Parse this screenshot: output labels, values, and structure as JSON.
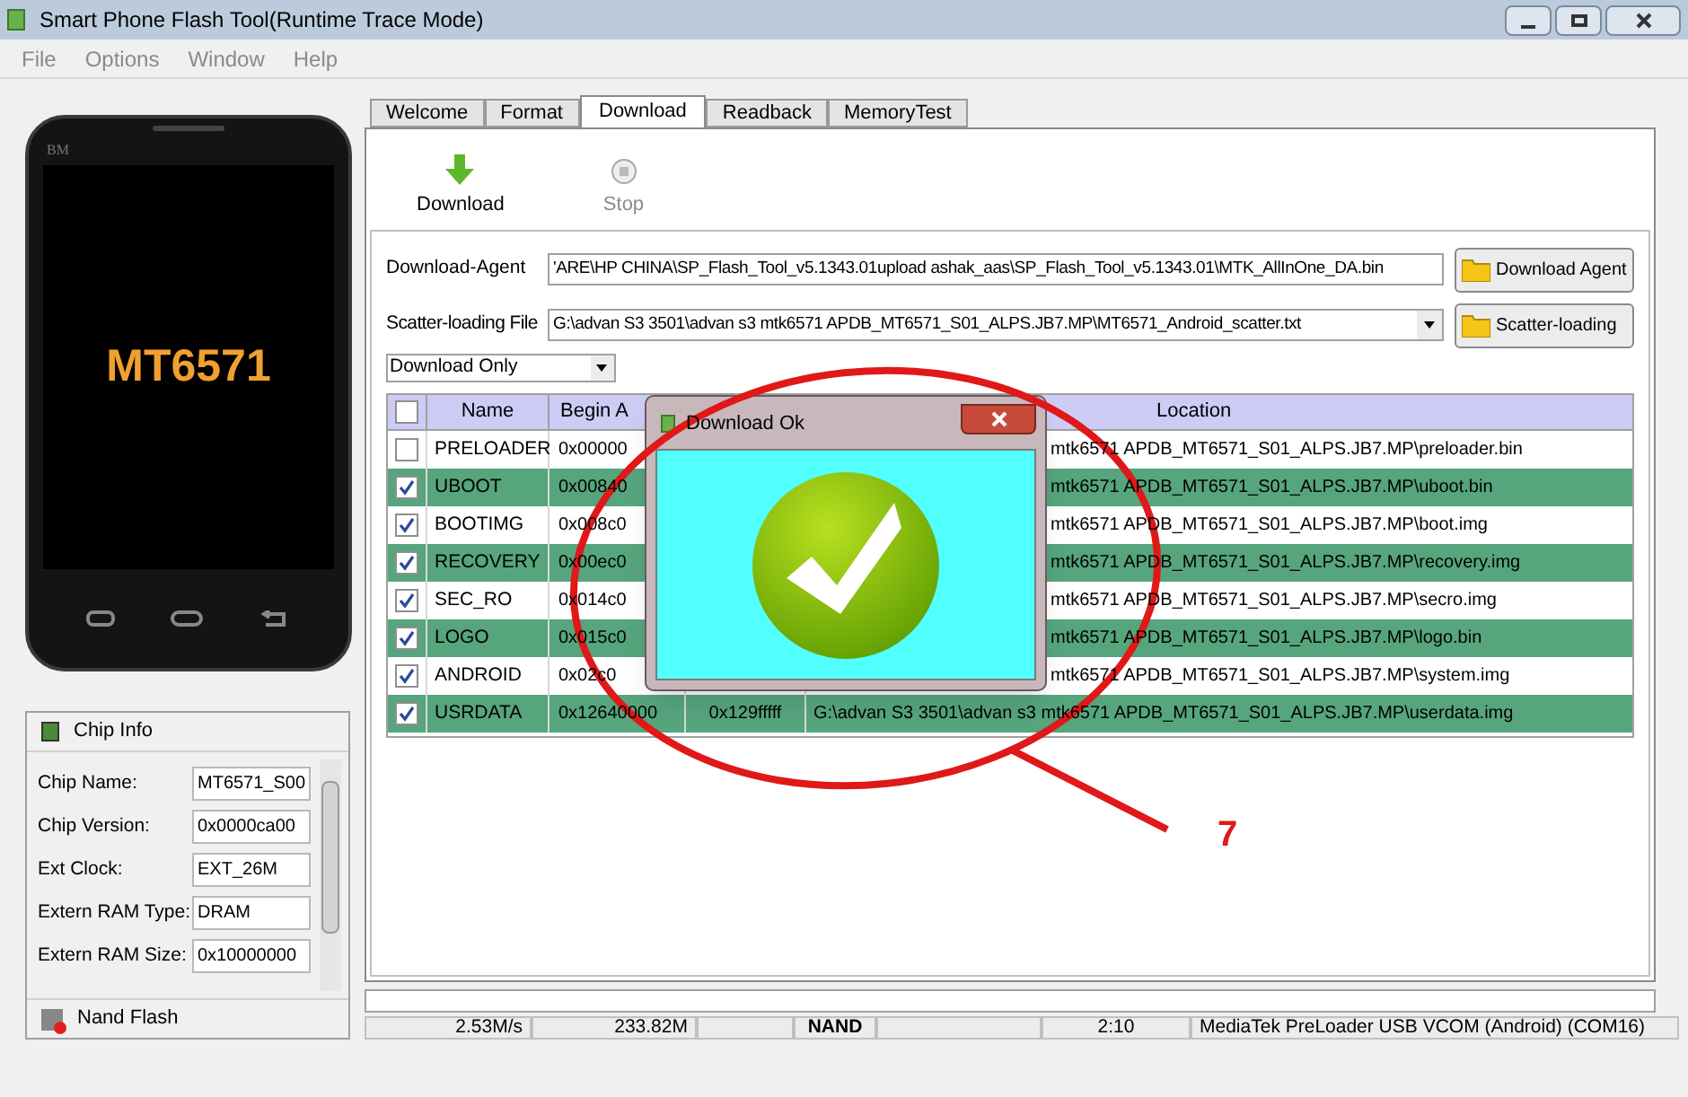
{
  "window": {
    "title": "Smart Phone Flash Tool(Runtime Trace Mode)"
  },
  "menu": [
    {
      "label": "File",
      "disabled": true
    },
    {
      "label": "Options",
      "disabled": true
    },
    {
      "label": "Window",
      "disabled": true
    },
    {
      "label": "Help",
      "disabled": true
    }
  ],
  "phone": {
    "brand": "BM",
    "chip": "MT6571"
  },
  "chip_info": {
    "title": "Chip Info",
    "fields": [
      {
        "label": "Chip Name:",
        "value": "MT6571_S00"
      },
      {
        "label": "Chip Version:",
        "value": "0x0000ca00"
      },
      {
        "label": "Ext Clock:",
        "value": "EXT_26M"
      },
      {
        "label": "Extern RAM Type:",
        "value": "DRAM"
      },
      {
        "label": "Extern RAM Size:",
        "value": "0x10000000"
      }
    ]
  },
  "nand_flash": {
    "title": "Nand Flash"
  },
  "tabs": [
    {
      "label": "Welcome",
      "selected": false
    },
    {
      "label": "Format",
      "selected": false
    },
    {
      "label": "Download",
      "selected": true
    },
    {
      "label": "Readback",
      "selected": false
    },
    {
      "label": "MemoryTest",
      "selected": false
    }
  ],
  "toolbar": [
    {
      "label": "Download",
      "kind": "download",
      "disabled": false
    },
    {
      "label": "Stop",
      "kind": "stop",
      "disabled": true
    }
  ],
  "download_agent": {
    "label": "Download-Agent",
    "value": "'ARE\\HP CHINA\\SP_Flash_Tool_v5.1343.01upload ashak_aas\\SP_Flash_Tool_v5.1343.01\\MTK_AllInOne_DA.bin",
    "button": "Download Agent"
  },
  "scatter": {
    "label": "Scatter-loading File",
    "value": "G:\\advan S3 3501\\advan s3 mtk6571 APDB_MT6571_S01_ALPS.JB7.MP\\MT6571_Android_scatter.txt",
    "button": "Scatter-loading"
  },
  "mode_select": {
    "value": "Download Only"
  },
  "table": {
    "all_checked": false,
    "columns": [
      "Name",
      "Begin A",
      "Location"
    ],
    "rows": [
      {
        "checked": false,
        "covered": true,
        "name": "PRELOADER",
        "begin": "0x00000",
        "location": "mtk6571 APDB_MT6571_S01_ALPS.JB7.MP\\preloader.bin"
      },
      {
        "checked": true,
        "covered": true,
        "name": "UBOOT",
        "begin": "0x00840",
        "location": "mtk6571 APDB_MT6571_S01_ALPS.JB7.MP\\uboot.bin"
      },
      {
        "checked": true,
        "covered": true,
        "name": "BOOTIMG",
        "begin": "0x008c0",
        "location": "mtk6571 APDB_MT6571_S01_ALPS.JB7.MP\\boot.img"
      },
      {
        "checked": true,
        "covered": true,
        "name": "RECOVERY",
        "begin": "0x00ec0",
        "location": "mtk6571 APDB_MT6571_S01_ALPS.JB7.MP\\recovery.img"
      },
      {
        "checked": true,
        "covered": true,
        "name": "SEC_RO",
        "begin": "0x014c0",
        "location": "mtk6571 APDB_MT6571_S01_ALPS.JB7.MP\\secro.img"
      },
      {
        "checked": true,
        "covered": true,
        "name": "LOGO",
        "begin": "0x015c0",
        "location": "mtk6571 APDB_MT6571_S01_ALPS.JB7.MP\\logo.bin"
      },
      {
        "checked": true,
        "covered": true,
        "name": "ANDROID",
        "begin": "0x02c0",
        "location": "mtk6571 APDB_MT6571_S01_ALPS.JB7.MP\\system.img"
      },
      {
        "checked": true,
        "covered": false,
        "name": "USRDATA",
        "begin": "0x12640000",
        "end": "0x129fffff",
        "location": "G:\\advan S3 3501\\advan s3 mtk6571 APDB_MT6571_S01_ALPS.JB7.MP\\userdata.img"
      }
    ]
  },
  "dialog": {
    "title": "Download Ok"
  },
  "progress": {
    "level": 0
  },
  "status_bar": [
    "2.53M/s",
    "233.82M",
    "NAND",
    "2:10",
    "MediaTek PreLoader USB VCOM (Android) (COM16)"
  ],
  "annotation": {
    "label": "7"
  }
}
